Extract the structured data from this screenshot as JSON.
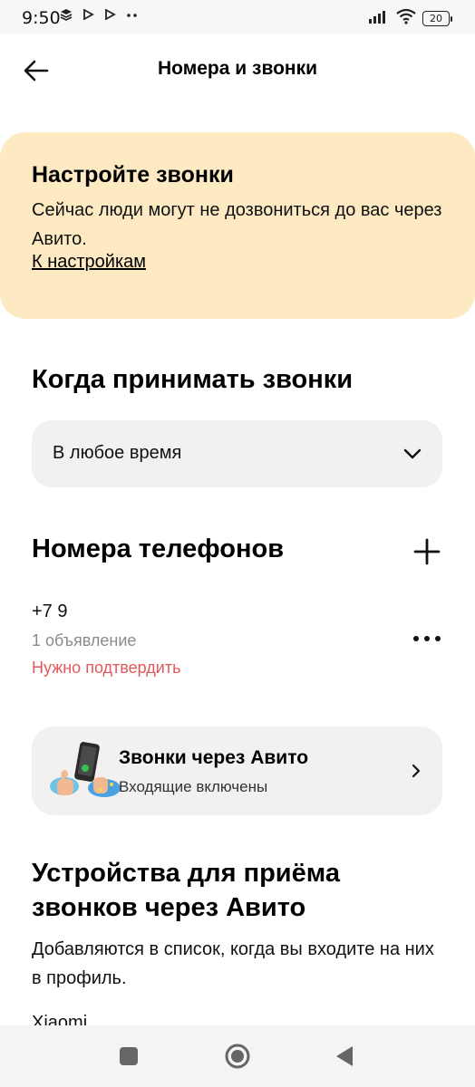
{
  "status_bar": {
    "time": "9:50",
    "icons_left": [
      "stack-icon",
      "play-icon",
      "play-icon",
      "more-icon"
    ],
    "icons_right": [
      "signal-icon",
      "wifi-icon",
      "battery-icon"
    ],
    "battery": "20"
  },
  "header": {
    "title": "Номера и звонки"
  },
  "banner": {
    "title": "Настройте звонки",
    "text": "Сейчас люди могут не дозвониться до вас через Авито.",
    "link": "К настройкам",
    "bg_color": "#fdeac3"
  },
  "when_section": {
    "title": "Когда принимать звонки",
    "select_value": "В любое время"
  },
  "phones_section": {
    "title": "Номера телефонов",
    "phone": {
      "number": "+7 9",
      "ads": "1 объявление",
      "status": "Нужно подтвердить",
      "status_color": "#e3585b"
    }
  },
  "calls_card": {
    "title": "Звонки через Авито",
    "subtitle": "Входящие включены"
  },
  "devices_section": {
    "title": "Устройства для приёма звонков через Авито",
    "description": "Добавляются в список, когда вы входите на них в профиль.",
    "first_device": "Xiaomi"
  },
  "nav_bar": {
    "buttons": [
      "recents-icon",
      "home-icon",
      "back-icon"
    ]
  }
}
